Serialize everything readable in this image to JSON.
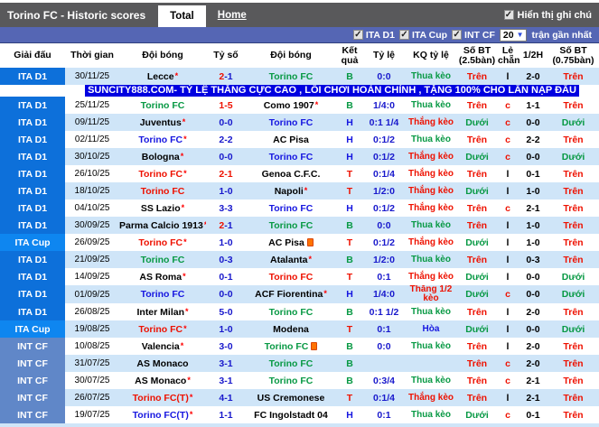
{
  "window": {
    "title": "Torino FC - Historic scores",
    "tabs": [
      {
        "label": "Total",
        "active": true
      },
      {
        "label": "Home",
        "active": false
      }
    ],
    "note_toggle": {
      "label": "Hiển thị ghi chú",
      "checked": true
    }
  },
  "filters": {
    "leagues": [
      {
        "label": "ITA D1",
        "checked": true
      },
      {
        "label": "ITA Cup",
        "checked": true
      },
      {
        "label": "INT CF",
        "checked": true
      }
    ],
    "count": "20",
    "count_suffix": "trận gần nhất"
  },
  "banner": {
    "after_row": 1,
    "text": "SUNCITY888.COM- TỶ LỆ THẮNG CỰC CAO , LỐI CHƠI HOÀN CHỈNH , TẶNG 100% CHO LẦN NẠP ĐẦU"
  },
  "colors": {
    "league_ita_d1": "#0d70da",
    "league_ita_cup": "#0e86f0",
    "league_int_cf": "#6087c8",
    "row_alt": "#cfe5f8",
    "top_bar": "#59595b",
    "filter_bar": "#5566b4",
    "banner_bg": "#0000e0",
    "win_red": "#ee1100",
    "loss_green": "#089944",
    "draw_blue": "#1616e0",
    "score_navy": "#1818cc"
  },
  "table": {
    "headers": [
      "Giải đấu",
      "Thời gian",
      "Đội bóng",
      "Tỷ số",
      "Đội bóng",
      "Kết quả",
      "Tỷ lệ",
      "KQ tỷ lệ",
      "Số BT (2.5bàn)",
      "Lẻ chẵn",
      "1/2H",
      "Số BT (0.75bàn)"
    ],
    "rows": [
      {
        "league": "ITA D1",
        "lk": "d1",
        "date": "30/11/25",
        "home": {
          "n": "Lecce",
          "c": "k",
          "star": true
        },
        "score": {
          "h": "2",
          "a": "1",
          "hc": "r",
          "ac": "n"
        },
        "away": {
          "n": "Torino FC",
          "c": "g"
        },
        "res": {
          "t": "B",
          "c": "g"
        },
        "odds": "0:0",
        "kq": {
          "t": "Thua kèo",
          "c": "g"
        },
        "ou25": {
          "t": "Trên",
          "c": "r"
        },
        "oe": {
          "t": "l",
          "c": "k"
        },
        "half": "2-0",
        "ou075": {
          "t": "Trên",
          "c": "r"
        }
      },
      {
        "league": "ITA D1",
        "lk": "d1",
        "date": "25/11/25",
        "home": {
          "n": "Torino FC",
          "c": "g"
        },
        "score": {
          "h": "1",
          "a": "5",
          "hc": "r",
          "ac": "r"
        },
        "away": {
          "n": "Como 1907",
          "c": "k",
          "star": true
        },
        "res": {
          "t": "B",
          "c": "g"
        },
        "odds": "1/4:0",
        "kq": {
          "t": "Thua kèo",
          "c": "g"
        },
        "ou25": {
          "t": "Trên",
          "c": "r"
        },
        "oe": {
          "t": "c",
          "c": "r"
        },
        "half": "1-1",
        "ou075": {
          "t": "Trên",
          "c": "r"
        }
      },
      {
        "league": "ITA D1",
        "lk": "d1",
        "date": "09/11/25",
        "home": {
          "n": "Juventus",
          "c": "k",
          "star": true
        },
        "score": {
          "h": "0",
          "a": "0",
          "hc": "n",
          "ac": "n"
        },
        "away": {
          "n": "Torino FC",
          "c": "b"
        },
        "res": {
          "t": "H",
          "c": "b"
        },
        "odds": "0:1 1/4",
        "kq": {
          "t": "Thắng kèo",
          "c": "r"
        },
        "ou25": {
          "t": "Dưới",
          "c": "g"
        },
        "oe": {
          "t": "c",
          "c": "r"
        },
        "half": "0-0",
        "ou075": {
          "t": "Dưới",
          "c": "g"
        }
      },
      {
        "league": "ITA D1",
        "lk": "d1",
        "date": "02/11/25",
        "home": {
          "n": "Torino FC",
          "c": "b",
          "star": true
        },
        "score": {
          "h": "2",
          "a": "2",
          "hc": "n",
          "ac": "n"
        },
        "away": {
          "n": "AC Pisa",
          "c": "k"
        },
        "res": {
          "t": "H",
          "c": "b"
        },
        "odds": "0:1/2",
        "kq": {
          "t": "Thua kèo",
          "c": "g"
        },
        "ou25": {
          "t": "Trên",
          "c": "r"
        },
        "oe": {
          "t": "c",
          "c": "r"
        },
        "half": "2-2",
        "ou075": {
          "t": "Trên",
          "c": "r"
        }
      },
      {
        "league": "ITA D1",
        "lk": "d1",
        "date": "30/10/25",
        "home": {
          "n": "Bologna",
          "c": "k",
          "star": true
        },
        "score": {
          "h": "0",
          "a": "0",
          "hc": "n",
          "ac": "n"
        },
        "away": {
          "n": "Torino FC",
          "c": "b"
        },
        "res": {
          "t": "H",
          "c": "b"
        },
        "odds": "0:1/2",
        "kq": {
          "t": "Thắng kèo",
          "c": "r"
        },
        "ou25": {
          "t": "Dưới",
          "c": "g"
        },
        "oe": {
          "t": "c",
          "c": "r"
        },
        "half": "0-0",
        "ou075": {
          "t": "Dưới",
          "c": "g"
        }
      },
      {
        "league": "ITA D1",
        "lk": "d1",
        "date": "26/10/25",
        "home": {
          "n": "Torino FC",
          "c": "r",
          "star": true
        },
        "score": {
          "h": "2",
          "a": "1",
          "hc": "r",
          "ac": "r"
        },
        "away": {
          "n": "Genoa C.F.C.",
          "c": "k"
        },
        "res": {
          "t": "T",
          "c": "r"
        },
        "odds": "0:1/4",
        "kq": {
          "t": "Thắng kèo",
          "c": "r"
        },
        "ou25": {
          "t": "Trên",
          "c": "r"
        },
        "oe": {
          "t": "l",
          "c": "k"
        },
        "half": "0-1",
        "ou075": {
          "t": "Trên",
          "c": "r"
        }
      },
      {
        "league": "ITA D1",
        "lk": "d1",
        "date": "18/10/25",
        "home": {
          "n": "Torino FC",
          "c": "r"
        },
        "score": {
          "h": "1",
          "a": "0",
          "hc": "n",
          "ac": "n"
        },
        "away": {
          "n": "Napoli",
          "c": "k",
          "star": true
        },
        "res": {
          "t": "T",
          "c": "r"
        },
        "odds": "1/2:0",
        "kq": {
          "t": "Thắng kèo",
          "c": "r"
        },
        "ou25": {
          "t": "Dưới",
          "c": "g"
        },
        "oe": {
          "t": "l",
          "c": "k"
        },
        "half": "1-0",
        "ou075": {
          "t": "Trên",
          "c": "r"
        }
      },
      {
        "league": "ITA D1",
        "lk": "d1",
        "date": "04/10/25",
        "home": {
          "n": "SS Lazio",
          "c": "k",
          "star": true
        },
        "score": {
          "h": "3",
          "a": "3",
          "hc": "n",
          "ac": "n"
        },
        "away": {
          "n": "Torino FC",
          "c": "b"
        },
        "res": {
          "t": "H",
          "c": "b"
        },
        "odds": "0:1/2",
        "kq": {
          "t": "Thắng kèo",
          "c": "r"
        },
        "ou25": {
          "t": "Trên",
          "c": "r"
        },
        "oe": {
          "t": "c",
          "c": "r"
        },
        "half": "2-1",
        "ou075": {
          "t": "Trên",
          "c": "r"
        }
      },
      {
        "league": "ITA D1",
        "lk": "d1",
        "date": "30/09/25",
        "home": {
          "n": "Parma Calcio 1913",
          "c": "k",
          "star": true
        },
        "score": {
          "h": "2",
          "a": "1",
          "hc": "r",
          "ac": "n"
        },
        "away": {
          "n": "Torino FC",
          "c": "g"
        },
        "res": {
          "t": "B",
          "c": "g"
        },
        "odds": "0:0",
        "kq": {
          "t": "Thua kèo",
          "c": "g"
        },
        "ou25": {
          "t": "Trên",
          "c": "r"
        },
        "oe": {
          "t": "l",
          "c": "k"
        },
        "half": "1-0",
        "ou075": {
          "t": "Trên",
          "c": "r"
        }
      },
      {
        "league": "ITA Cup",
        "lk": "cup",
        "date": "26/09/25",
        "home": {
          "n": "Torino FC",
          "c": "r",
          "star": true
        },
        "score": {
          "h": "1",
          "a": "0",
          "hc": "n",
          "ac": "n"
        },
        "away": {
          "n": "AC Pisa",
          "c": "k",
          "icon": true
        },
        "res": {
          "t": "T",
          "c": "r"
        },
        "odds": "0:1/2",
        "kq": {
          "t": "Thắng kèo",
          "c": "r"
        },
        "ou25": {
          "t": "Dưới",
          "c": "g"
        },
        "oe": {
          "t": "l",
          "c": "k"
        },
        "half": "1-0",
        "ou075": {
          "t": "Trên",
          "c": "r"
        }
      },
      {
        "league": "ITA D1",
        "lk": "d1",
        "date": "21/09/25",
        "home": {
          "n": "Torino FC",
          "c": "g"
        },
        "score": {
          "h": "0",
          "a": "3",
          "hc": "n",
          "ac": "n"
        },
        "away": {
          "n": "Atalanta",
          "c": "k",
          "star": true
        },
        "res": {
          "t": "B",
          "c": "g"
        },
        "odds": "1/2:0",
        "kq": {
          "t": "Thua kèo",
          "c": "g"
        },
        "ou25": {
          "t": "Trên",
          "c": "r"
        },
        "oe": {
          "t": "l",
          "c": "k"
        },
        "half": "0-3",
        "ou075": {
          "t": "Trên",
          "c": "r"
        }
      },
      {
        "league": "ITA D1",
        "lk": "d1",
        "date": "14/09/25",
        "home": {
          "n": "AS Roma",
          "c": "k",
          "star": true
        },
        "score": {
          "h": "0",
          "a": "1",
          "hc": "n",
          "ac": "n"
        },
        "away": {
          "n": "Torino FC",
          "c": "r"
        },
        "res": {
          "t": "T",
          "c": "r"
        },
        "odds": "0:1",
        "kq": {
          "t": "Thắng kèo",
          "c": "r"
        },
        "ou25": {
          "t": "Dưới",
          "c": "g"
        },
        "oe": {
          "t": "l",
          "c": "k"
        },
        "half": "0-0",
        "ou075": {
          "t": "Dưới",
          "c": "g"
        }
      },
      {
        "league": "ITA D1",
        "lk": "d1",
        "date": "01/09/25",
        "home": {
          "n": "Torino FC",
          "c": "b"
        },
        "score": {
          "h": "0",
          "a": "0",
          "hc": "n",
          "ac": "n"
        },
        "away": {
          "n": "ACF Fiorentina",
          "c": "k",
          "star": true
        },
        "res": {
          "t": "H",
          "c": "b"
        },
        "odds": "1/4:0",
        "kq": {
          "t": "Thắng 1/2 kèo",
          "c": "r"
        },
        "ou25": {
          "t": "Dưới",
          "c": "g"
        },
        "oe": {
          "t": "c",
          "c": "r"
        },
        "half": "0-0",
        "ou075": {
          "t": "Dưới",
          "c": "g"
        }
      },
      {
        "league": "ITA D1",
        "lk": "d1",
        "date": "26/08/25",
        "home": {
          "n": "Inter Milan",
          "c": "k",
          "star": true
        },
        "score": {
          "h": "5",
          "a": "0",
          "hc": "n",
          "ac": "n"
        },
        "away": {
          "n": "Torino FC",
          "c": "g"
        },
        "res": {
          "t": "B",
          "c": "g"
        },
        "odds": "0:1 1/2",
        "kq": {
          "t": "Thua kèo",
          "c": "g"
        },
        "ou25": {
          "t": "Trên",
          "c": "r"
        },
        "oe": {
          "t": "l",
          "c": "k"
        },
        "half": "2-0",
        "ou075": {
          "t": "Trên",
          "c": "r"
        }
      },
      {
        "league": "ITA Cup",
        "lk": "cup",
        "date": "19/08/25",
        "home": {
          "n": "Torino FC",
          "c": "r",
          "star": true
        },
        "score": {
          "h": "1",
          "a": "0",
          "hc": "n",
          "ac": "n"
        },
        "away": {
          "n": "Modena",
          "c": "k"
        },
        "res": {
          "t": "T",
          "c": "r"
        },
        "odds": "0:1",
        "kq": {
          "t": "Hòa",
          "c": "b"
        },
        "ou25": {
          "t": "Dưới",
          "c": "g"
        },
        "oe": {
          "t": "l",
          "c": "k"
        },
        "half": "0-0",
        "ou075": {
          "t": "Dưới",
          "c": "g"
        }
      },
      {
        "league": "INT CF",
        "lk": "int",
        "date": "10/08/25",
        "home": {
          "n": "Valencia",
          "c": "k",
          "star": true
        },
        "score": {
          "h": "3",
          "a": "0",
          "hc": "n",
          "ac": "n"
        },
        "away": {
          "n": "Torino FC",
          "c": "g",
          "icon": true
        },
        "res": {
          "t": "B",
          "c": "g"
        },
        "odds": "0:0",
        "kq": {
          "t": "Thua kèo",
          "c": "g"
        },
        "ou25": {
          "t": "Trên",
          "c": "r"
        },
        "oe": {
          "t": "l",
          "c": "k"
        },
        "half": "2-0",
        "ou075": {
          "t": "Trên",
          "c": "r"
        }
      },
      {
        "league": "INT CF",
        "lk": "int",
        "date": "31/07/25",
        "home": {
          "n": "AS Monaco",
          "c": "k"
        },
        "score": {
          "h": "3",
          "a": "1",
          "hc": "n",
          "ac": "n"
        },
        "away": {
          "n": "Torino FC",
          "c": "g"
        },
        "res": {
          "t": "B",
          "c": "g"
        },
        "odds": "",
        "kq": {
          "t": "",
          "c": "k"
        },
        "ou25": {
          "t": "Trên",
          "c": "r"
        },
        "oe": {
          "t": "c",
          "c": "r"
        },
        "half": "2-0",
        "ou075": {
          "t": "Trên",
          "c": "r"
        }
      },
      {
        "league": "INT CF",
        "lk": "int",
        "date": "30/07/25",
        "home": {
          "n": "AS Monaco",
          "c": "k",
          "star": true
        },
        "score": {
          "h": "3",
          "a": "1",
          "hc": "n",
          "ac": "n"
        },
        "away": {
          "n": "Torino FC",
          "c": "g"
        },
        "res": {
          "t": "B",
          "c": "g"
        },
        "odds": "0:3/4",
        "kq": {
          "t": "Thua kèo",
          "c": "g"
        },
        "ou25": {
          "t": "Trên",
          "c": "r"
        },
        "oe": {
          "t": "c",
          "c": "r"
        },
        "half": "2-1",
        "ou075": {
          "t": "Trên",
          "c": "r"
        }
      },
      {
        "league": "INT CF",
        "lk": "int",
        "date": "26/07/25",
        "home": {
          "n": "Torino FC(T)",
          "c": "r",
          "star": true
        },
        "score": {
          "h": "4",
          "a": "1",
          "hc": "n",
          "ac": "n"
        },
        "away": {
          "n": "US Cremonese",
          "c": "k"
        },
        "res": {
          "t": "T",
          "c": "r"
        },
        "odds": "0:1/4",
        "kq": {
          "t": "Thắng kèo",
          "c": "r"
        },
        "ou25": {
          "t": "Trên",
          "c": "r"
        },
        "oe": {
          "t": "l",
          "c": "k"
        },
        "half": "2-1",
        "ou075": {
          "t": "Trên",
          "c": "r"
        }
      },
      {
        "league": "INT CF",
        "lk": "int",
        "date": "19/07/25",
        "home": {
          "n": "Torino FC(T)",
          "c": "b",
          "star": true
        },
        "score": {
          "h": "1",
          "a": "1",
          "hc": "n",
          "ac": "n"
        },
        "away": {
          "n": "FC Ingolstadt 04",
          "c": "k"
        },
        "res": {
          "t": "H",
          "c": "b"
        },
        "odds": "0:1",
        "kq": {
          "t": "Thua kèo",
          "c": "g"
        },
        "ou25": {
          "t": "Dưới",
          "c": "g"
        },
        "oe": {
          "t": "c",
          "c": "r"
        },
        "half": "0-1",
        "ou075": {
          "t": "Trên",
          "c": "r"
        }
      }
    ]
  }
}
